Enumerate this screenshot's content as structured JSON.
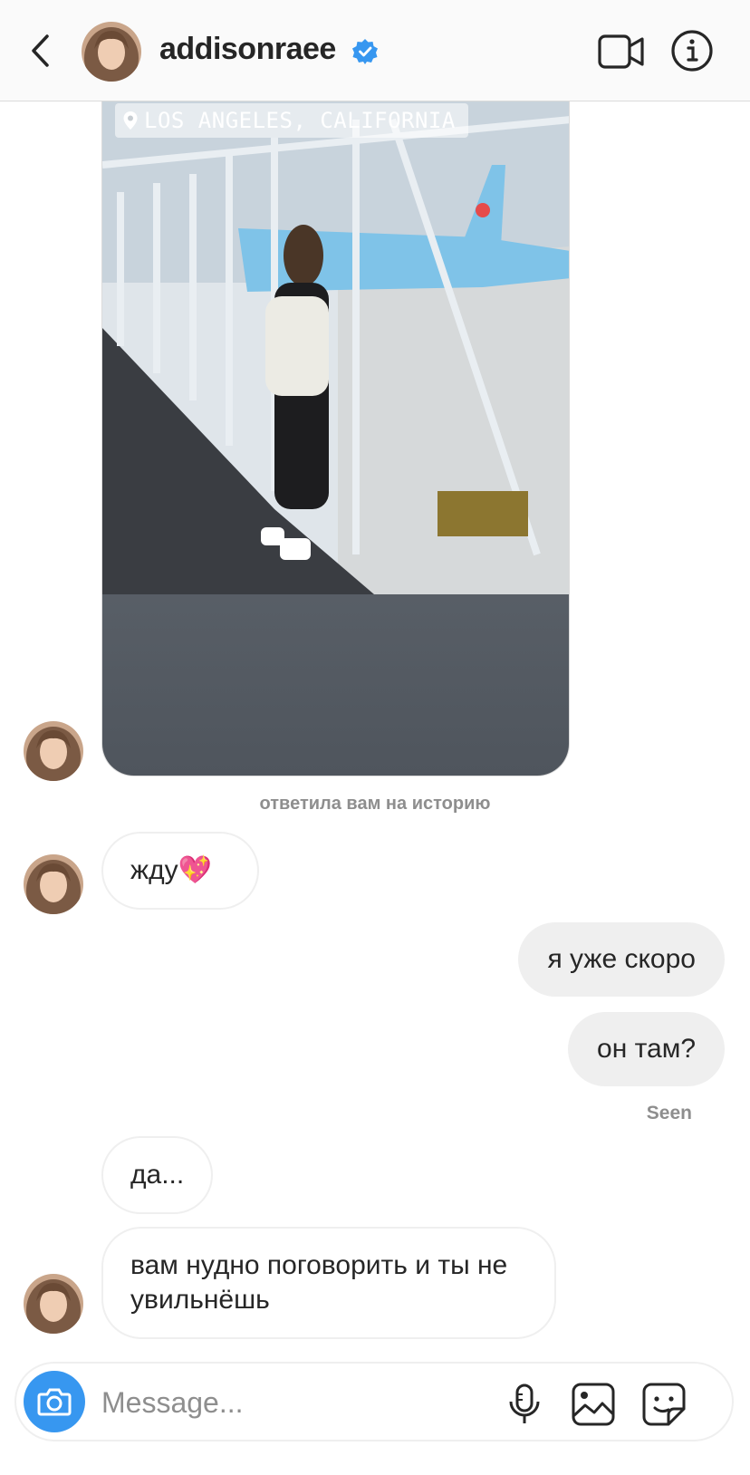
{
  "header": {
    "username": "addisonraee",
    "verified": true,
    "accent_color": "#3797f0"
  },
  "story": {
    "location": "LOS ANGELES, CALIFORNIA",
    "reply_caption": "ответила вам на историю"
  },
  "messages": [
    {
      "from": "them",
      "text": "жду💖"
    },
    {
      "from": "me",
      "text": "я уже скоро"
    },
    {
      "from": "me",
      "text": "он там?"
    },
    {
      "from": "them",
      "text": "да..."
    },
    {
      "from": "them",
      "text": "вам нудно поговорить и ты не увильнёшь"
    }
  ],
  "status": {
    "seen": "Seen"
  },
  "composer": {
    "placeholder": "Message..."
  },
  "icons": {
    "back": "chevron-left-icon",
    "video": "video-camera-icon",
    "info": "info-icon",
    "camera": "camera-icon",
    "mic": "microphone-icon",
    "gallery": "gallery-icon",
    "sticker": "sticker-icon"
  }
}
